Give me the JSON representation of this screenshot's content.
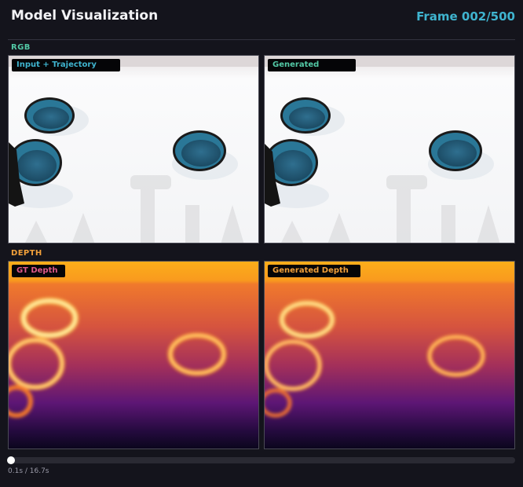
{
  "header": {
    "title": "Model Visualization",
    "frame_label": "Frame 002/500"
  },
  "sections": {
    "rgb": "RGB",
    "depth": "DEPTH"
  },
  "panels": {
    "rgb_input": "Input + Trajectory",
    "rgb_generated": "Generated",
    "depth_gt": "GT Depth",
    "depth_generated": "Generated Depth"
  },
  "playback": {
    "time": "0.1s / 16.7s",
    "progress": 0.006
  },
  "colors": {
    "accent": "#3fb4cf",
    "rgb_section": "#53c9a6",
    "depth_section": "#f2a03a",
    "gt_label": "#e05a8a"
  }
}
